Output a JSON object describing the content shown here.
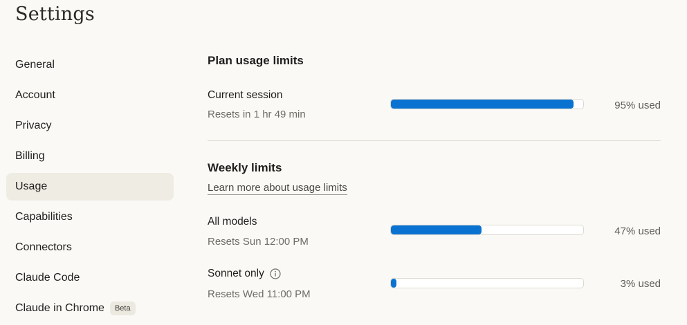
{
  "page": {
    "title": "Settings"
  },
  "sidebar": {
    "items": [
      {
        "label": "General"
      },
      {
        "label": "Account"
      },
      {
        "label": "Privacy"
      },
      {
        "label": "Billing"
      },
      {
        "label": "Usage",
        "active": true
      },
      {
        "label": "Capabilities"
      },
      {
        "label": "Connectors"
      },
      {
        "label": "Claude Code"
      },
      {
        "label": "Claude in Chrome",
        "badge": "Beta"
      }
    ]
  },
  "plan": {
    "title": "Plan usage limits",
    "current_session": {
      "label": "Current session",
      "reset": "Resets in 1 hr 49 min",
      "used_text": "95% used",
      "used_fraction": 0.95
    }
  },
  "weekly": {
    "title": "Weekly limits",
    "learn_more": "Learn more about usage limits",
    "all_models": {
      "label": "All models",
      "reset": "Resets Sun 12:00 PM",
      "used_text": "47% used",
      "used_fraction": 0.47
    },
    "sonnet_only": {
      "label": "Sonnet only",
      "info_icon": "info-circle-icon",
      "reset": "Resets Wed 11:00 PM",
      "used_text": "3% used",
      "used_fraction": 0.03
    }
  },
  "colors": {
    "accent": "#0a73d1",
    "background": "#faf9f5",
    "active_nav": "#efece4"
  }
}
